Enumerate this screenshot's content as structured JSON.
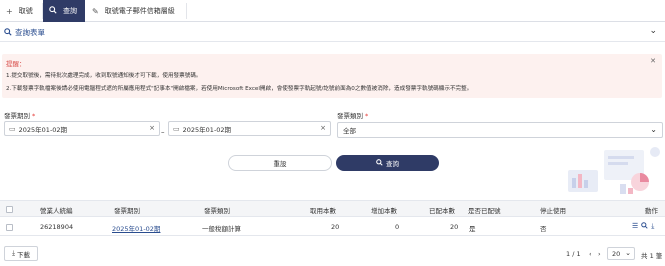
{
  "tabs": [
    {
      "icon": "+",
      "label": "取號"
    },
    {
      "icon": "🔍",
      "label": "查詢"
    },
    {
      "icon": "✎",
      "label": "取號電子郵件信箱層級"
    }
  ],
  "panel": {
    "title": "查詢表單"
  },
  "alert": {
    "title": "提醒：",
    "line1": "1.提交取號後，需待批次處理完成，收到取號通知後才可下載，使用發票號碼。",
    "line2": "2.下載發票字軌檔案後請必使用電腦程式遮的所屬應用程式\"記事本\"開啟檔案，若使用Microsoft Excel開啟，會使發票字軌起號/訖號前面為0之數值被消除，造成發票字軌號碼顯示不完整。"
  },
  "form": {
    "period_label": "發票期別",
    "period_from": "2025年01-02期",
    "period_to": "2025年01-02期",
    "type_label": "發票類別",
    "type_value": "全部"
  },
  "buttons": {
    "reset": "重設",
    "query": "查詢"
  },
  "table": {
    "headers": [
      "營業人統編",
      "發票期別",
      "發票類別",
      "取用本數",
      "增加本數",
      "已配本數",
      "是否已配號",
      "停止使用",
      "動作"
    ],
    "rows": [
      {
        "ban": "26218904",
        "period": "2025年01-02期",
        "type": "一般稅額計算",
        "taken": "20",
        "added": "0",
        "allocated": "20",
        "is_allocated": "是",
        "stopped": "否"
      }
    ]
  },
  "footer": {
    "download": "下載",
    "page_info": "1 / 1",
    "page_size": "20",
    "total": "共 1 筆"
  }
}
